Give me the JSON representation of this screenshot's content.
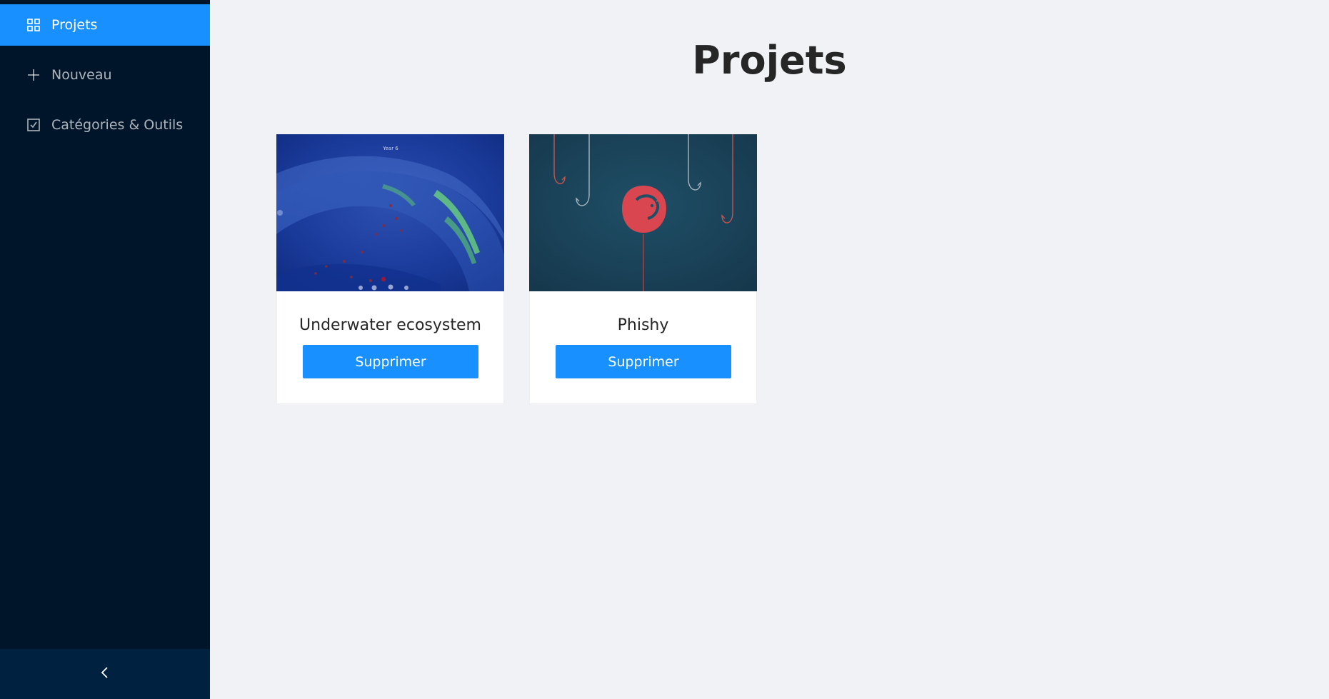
{
  "sidebar": {
    "items": [
      {
        "label": "Projets",
        "icon": "grid-icon",
        "active": true
      },
      {
        "label": "Nouveau",
        "icon": "plus-icon",
        "active": false
      },
      {
        "label": "Catégories & Outils",
        "icon": "checkbox-icon",
        "active": false
      }
    ],
    "collapse_icon": "chevron-left-icon"
  },
  "main": {
    "title": "Projets",
    "projects": [
      {
        "name": "Underwater ecosystem",
        "delete_label": "Supprimer",
        "cover": "underwater-scene",
        "cover_caption": "Year 6"
      },
      {
        "name": "Phishy",
        "delete_label": "Supprimer",
        "cover": "fish-hooks-scene"
      }
    ]
  },
  "colors": {
    "sidebar_bg": "#001529",
    "trigger_bg": "#002140",
    "accent": "#1890ff",
    "page_bg": "#f0f2f5"
  }
}
